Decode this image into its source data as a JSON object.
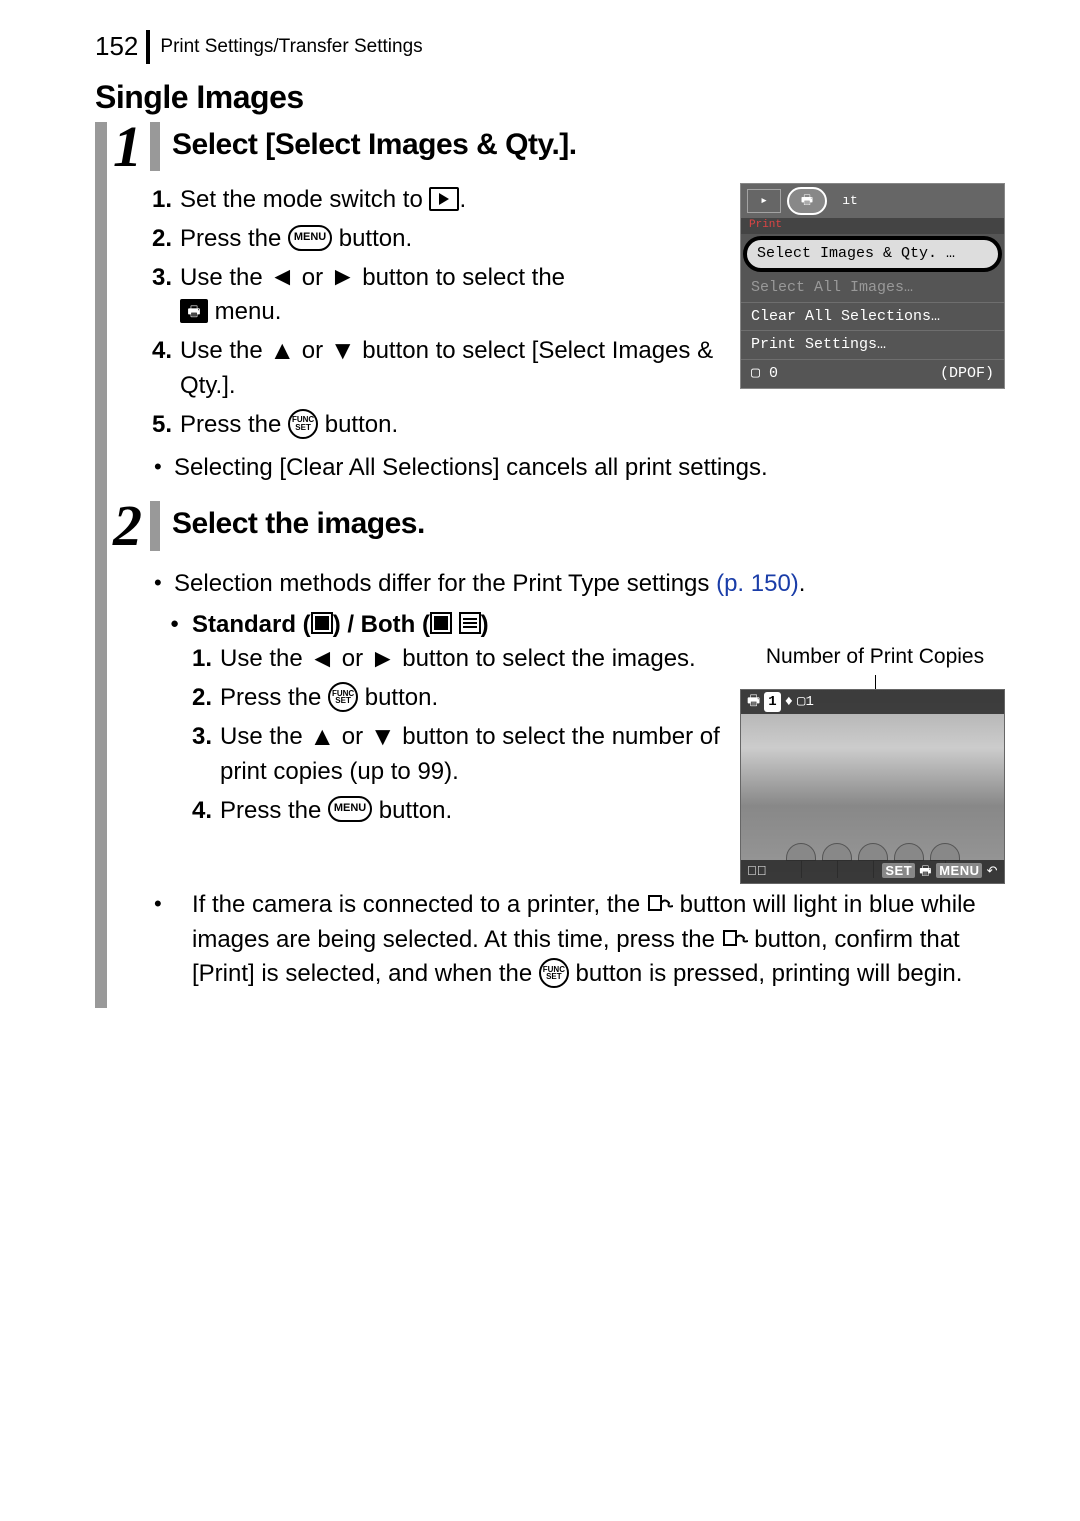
{
  "header": {
    "page_number": "152",
    "breadcrumb": "Print Settings/Transfer Settings"
  },
  "section_title": "Single Images",
  "step1": {
    "num": "1",
    "title": "Select [Select Images & Qty.].",
    "items": {
      "i1a": "Set the mode switch to ",
      "i1b": ".",
      "i2a": "Press the ",
      "i2b": " button.",
      "i3a": "Use the ",
      "i3b": " or ",
      "i3c": " button to select the ",
      "i3d": " menu.",
      "i4a": "Use the ",
      "i4b": " or ",
      "i4c": " button to select [Select Images & Qty.].",
      "i5a": "Press the ",
      "i5b": " button."
    },
    "note": "Selecting [Clear All Selections] cancels all print settings."
  },
  "step2": {
    "num": "2",
    "title": "Select the images.",
    "note_a": "Selection methods differ for the Print Type settings ",
    "link": "(p. 150)",
    "note_b": ".",
    "sub_title_a": "Standard (",
    "sub_title_b": ") / Both (",
    "sub_title_c": ")",
    "items": {
      "i1a": "Use the ",
      "i1b": " or ",
      "i1c": " button to select the images.",
      "i2a": "Press the ",
      "i2b": " button.",
      "i3a": "Use the ",
      "i3b": " or ",
      "i3c": " button to select the number of print copies (up to 99).",
      "i4a": "Press the ",
      "i4b": " button."
    },
    "foot_a": "If the camera is connected to a printer, the ",
    "foot_b": " button will light in blue while images are being selected. At this time, press the ",
    "foot_c": " button, confirm that [Print] is selected, and when the ",
    "foot_d": " button is pressed, printing will begin."
  },
  "screen1": {
    "sub": "Print",
    "selected": "Select Images & Qty. …",
    "row2": "Select All Images…",
    "row3": "Clear All Selections…",
    "row4": "Print Settings…",
    "foot_left": "▢ 0",
    "foot_right": "(DPOF)"
  },
  "screen2": {
    "caption": "Number of Print Copies",
    "bar_n1": "1",
    "bar_n2": "▢1",
    "foot_set": "SET",
    "foot_menu": "MENU"
  }
}
